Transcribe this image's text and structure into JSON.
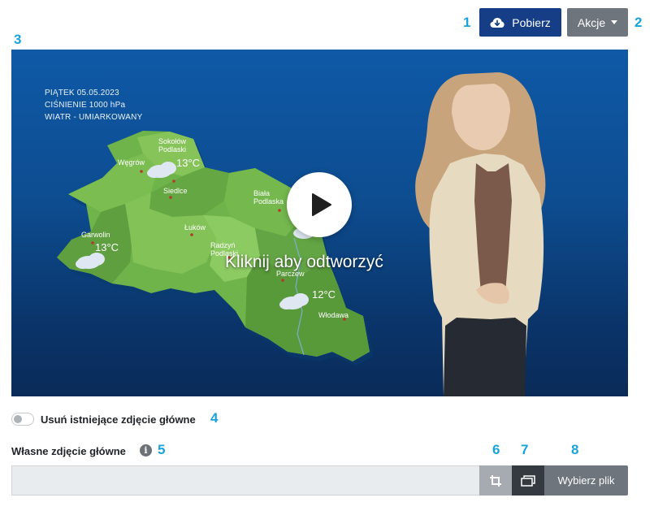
{
  "markers": {
    "m1": "1",
    "m2": "2",
    "m3": "3",
    "m4": "4",
    "m5": "5",
    "m6": "6",
    "m7": "7",
    "m8": "8"
  },
  "header": {
    "download_label": "Pobierz",
    "actions_label": "Akcje"
  },
  "video": {
    "info_line1": "PIĄTEK 05.05.2023",
    "info_line2": "CIŚNIENIE 1000 hPa",
    "info_line3": "WIATR - UMIARKOWANY",
    "play_caption": "Kliknij aby odtworzyć",
    "map": {
      "towns": [
        {
          "name": "Sokołów",
          "name2": "Podlaski"
        },
        {
          "name": "Węgrów"
        },
        {
          "name": "Siedlce"
        },
        {
          "name": "Biała",
          "name2": "Podlaska"
        },
        {
          "name": "Garwolin"
        },
        {
          "name": "Łuków"
        },
        {
          "name": "Radzyń",
          "name2": "Podlaski"
        },
        {
          "name": "Parczew"
        },
        {
          "name": "Włodawa"
        }
      ],
      "temps": [
        "13°C",
        "13°C",
        "12°C"
      ]
    }
  },
  "form": {
    "remove_main_label": "Usuń istniejące zdjęcie główne",
    "remove_main_checked": false,
    "own_main_label": "Własne zdjęcie główne",
    "info_glyph": "i",
    "file_value": "",
    "choose_file_label": "Wybierz plik"
  },
  "colors": {
    "primary": "#153e86",
    "secondary": "#6e757d",
    "marker": "#1aa3d9",
    "icon_btn_light": "#a5abb1",
    "icon_btn_dark": "#343a40"
  }
}
